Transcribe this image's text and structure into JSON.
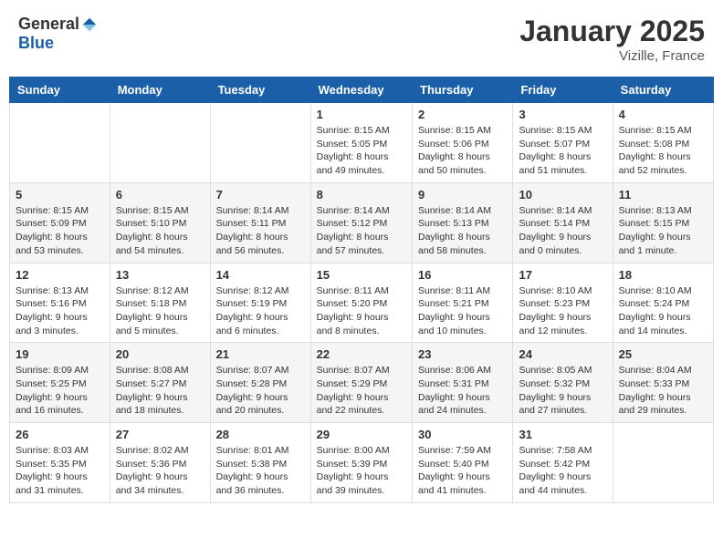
{
  "logo": {
    "general": "General",
    "blue": "Blue"
  },
  "title": "January 2025",
  "subtitle": "Vizille, France",
  "days_of_week": [
    "Sunday",
    "Monday",
    "Tuesday",
    "Wednesday",
    "Thursday",
    "Friday",
    "Saturday"
  ],
  "weeks": [
    [
      {
        "day": "",
        "info": ""
      },
      {
        "day": "",
        "info": ""
      },
      {
        "day": "",
        "info": ""
      },
      {
        "day": "1",
        "info": "Sunrise: 8:15 AM\nSunset: 5:05 PM\nDaylight: 8 hours and 49 minutes."
      },
      {
        "day": "2",
        "info": "Sunrise: 8:15 AM\nSunset: 5:06 PM\nDaylight: 8 hours and 50 minutes."
      },
      {
        "day": "3",
        "info": "Sunrise: 8:15 AM\nSunset: 5:07 PM\nDaylight: 8 hours and 51 minutes."
      },
      {
        "day": "4",
        "info": "Sunrise: 8:15 AM\nSunset: 5:08 PM\nDaylight: 8 hours and 52 minutes."
      }
    ],
    [
      {
        "day": "5",
        "info": "Sunrise: 8:15 AM\nSunset: 5:09 PM\nDaylight: 8 hours and 53 minutes."
      },
      {
        "day": "6",
        "info": "Sunrise: 8:15 AM\nSunset: 5:10 PM\nDaylight: 8 hours and 54 minutes."
      },
      {
        "day": "7",
        "info": "Sunrise: 8:14 AM\nSunset: 5:11 PM\nDaylight: 8 hours and 56 minutes."
      },
      {
        "day": "8",
        "info": "Sunrise: 8:14 AM\nSunset: 5:12 PM\nDaylight: 8 hours and 57 minutes."
      },
      {
        "day": "9",
        "info": "Sunrise: 8:14 AM\nSunset: 5:13 PM\nDaylight: 8 hours and 58 minutes."
      },
      {
        "day": "10",
        "info": "Sunrise: 8:14 AM\nSunset: 5:14 PM\nDaylight: 9 hours and 0 minutes."
      },
      {
        "day": "11",
        "info": "Sunrise: 8:13 AM\nSunset: 5:15 PM\nDaylight: 9 hours and 1 minute."
      }
    ],
    [
      {
        "day": "12",
        "info": "Sunrise: 8:13 AM\nSunset: 5:16 PM\nDaylight: 9 hours and 3 minutes."
      },
      {
        "day": "13",
        "info": "Sunrise: 8:12 AM\nSunset: 5:18 PM\nDaylight: 9 hours and 5 minutes."
      },
      {
        "day": "14",
        "info": "Sunrise: 8:12 AM\nSunset: 5:19 PM\nDaylight: 9 hours and 6 minutes."
      },
      {
        "day": "15",
        "info": "Sunrise: 8:11 AM\nSunset: 5:20 PM\nDaylight: 9 hours and 8 minutes."
      },
      {
        "day": "16",
        "info": "Sunrise: 8:11 AM\nSunset: 5:21 PM\nDaylight: 9 hours and 10 minutes."
      },
      {
        "day": "17",
        "info": "Sunrise: 8:10 AM\nSunset: 5:23 PM\nDaylight: 9 hours and 12 minutes."
      },
      {
        "day": "18",
        "info": "Sunrise: 8:10 AM\nSunset: 5:24 PM\nDaylight: 9 hours and 14 minutes."
      }
    ],
    [
      {
        "day": "19",
        "info": "Sunrise: 8:09 AM\nSunset: 5:25 PM\nDaylight: 9 hours and 16 minutes."
      },
      {
        "day": "20",
        "info": "Sunrise: 8:08 AM\nSunset: 5:27 PM\nDaylight: 9 hours and 18 minutes."
      },
      {
        "day": "21",
        "info": "Sunrise: 8:07 AM\nSunset: 5:28 PM\nDaylight: 9 hours and 20 minutes."
      },
      {
        "day": "22",
        "info": "Sunrise: 8:07 AM\nSunset: 5:29 PM\nDaylight: 9 hours and 22 minutes."
      },
      {
        "day": "23",
        "info": "Sunrise: 8:06 AM\nSunset: 5:31 PM\nDaylight: 9 hours and 24 minutes."
      },
      {
        "day": "24",
        "info": "Sunrise: 8:05 AM\nSunset: 5:32 PM\nDaylight: 9 hours and 27 minutes."
      },
      {
        "day": "25",
        "info": "Sunrise: 8:04 AM\nSunset: 5:33 PM\nDaylight: 9 hours and 29 minutes."
      }
    ],
    [
      {
        "day": "26",
        "info": "Sunrise: 8:03 AM\nSunset: 5:35 PM\nDaylight: 9 hours and 31 minutes."
      },
      {
        "day": "27",
        "info": "Sunrise: 8:02 AM\nSunset: 5:36 PM\nDaylight: 9 hours and 34 minutes."
      },
      {
        "day": "28",
        "info": "Sunrise: 8:01 AM\nSunset: 5:38 PM\nDaylight: 9 hours and 36 minutes."
      },
      {
        "day": "29",
        "info": "Sunrise: 8:00 AM\nSunset: 5:39 PM\nDaylight: 9 hours and 39 minutes."
      },
      {
        "day": "30",
        "info": "Sunrise: 7:59 AM\nSunset: 5:40 PM\nDaylight: 9 hours and 41 minutes."
      },
      {
        "day": "31",
        "info": "Sunrise: 7:58 AM\nSunset: 5:42 PM\nDaylight: 9 hours and 44 minutes."
      },
      {
        "day": "",
        "info": ""
      }
    ]
  ]
}
